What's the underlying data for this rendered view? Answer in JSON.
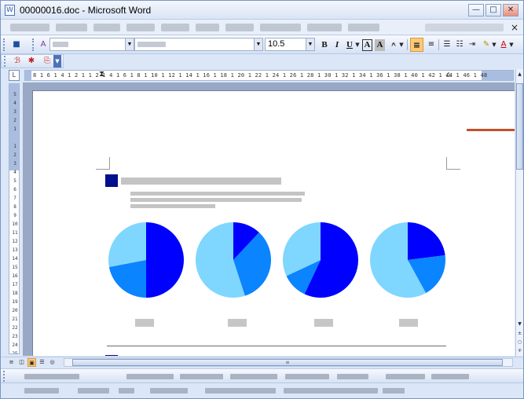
{
  "window": {
    "title": "00000016.doc - Microsoft Word",
    "doc_icon": "W",
    "minimize_glyph": "—",
    "restore_glyph": "□",
    "close_glyph": "✕"
  },
  "menubar": {
    "close_glyph": "×"
  },
  "toolbar": {
    "font_size": "10.5",
    "bold": "B",
    "italic": "I",
    "underline": "U",
    "char_border": "A",
    "char_shading": "A"
  },
  "ruler": {
    "corner_glyph": "L",
    "h_ticks": "8 1 6 1 4 1 2 1   1 2 1 4 1 6 1 8 1 10 1 12 1 14 1 16 1 18 1 20 1 22 1 24 1 26 1 28 1 30 1 32 1 34 1 36 1 38 1 40 1 42 1 44 1 46 1 48",
    "v_ticks": "5\n4\n3\n2\n1\n \n1\n2\n3\n4\n5\n6\n7\n8\n9\n10\n11\n12\n13\n14\n15\n16\n17\n18\n19\n20\n21\n22\n23\n24\n25\n26\n27\n28\n29\n30"
  },
  "colors": {
    "heading_square": "#000f8c",
    "accent_line": "#c3502a",
    "pie_dark": "#0000ff",
    "pie_mid": "#0a84ff",
    "pie_light": "#7fd6ff"
  },
  "pies": [
    {
      "slices": [
        50,
        22,
        28
      ]
    },
    {
      "slices": [
        12,
        33,
        55
      ]
    },
    {
      "slices": [
        57,
        11,
        32
      ]
    },
    {
      "slices": [
        23,
        19,
        58
      ]
    }
  ],
  "scrollbar": {
    "up": "▲",
    "down": "▼",
    "grip": "≡"
  },
  "viewbar": {
    "normal": "≡",
    "web": "◫",
    "print": "▣",
    "outline": "☰",
    "reading": "◎"
  }
}
